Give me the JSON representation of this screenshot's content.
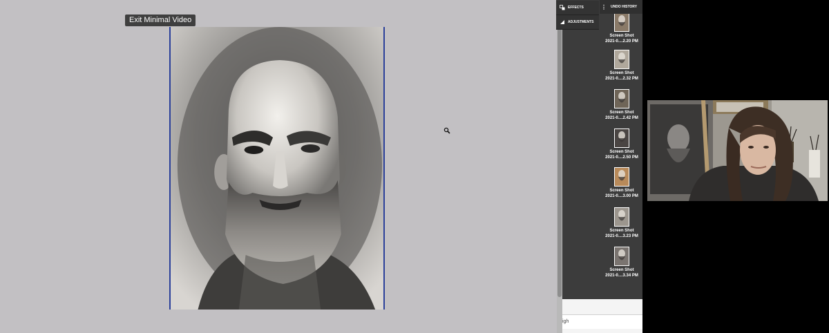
{
  "canvas": {
    "exit_button_label": "Exit Minimal Video",
    "background_color": "#c2c0c3"
  },
  "panel": {
    "tabs": [
      {
        "label": "EFFECTS",
        "icon": "effects-icon"
      },
      {
        "label": "ADJUSTMENTS",
        "icon": "adjustments-icon"
      }
    ],
    "undo_history_label": "UNDO HISTORY",
    "history_items": [
      {
        "line1": "Screen Shot",
        "line2": "2021-0....2.20 PM"
      },
      {
        "line1": "Screen Shot",
        "line2": "2021-0....2.32 PM"
      },
      {
        "line1": "Screen Shot",
        "line2": "2021-0....2.42 PM"
      },
      {
        "line1": "Screen Shot",
        "line2": "2021-0....2.50 PM"
      },
      {
        "line1": "Screen Shot",
        "line2": "2021-0....3.00 PM"
      },
      {
        "line1": "Screen Shot",
        "line2": "2021-0....3.23 PM"
      },
      {
        "line1": "Screen Shot",
        "line2": "2021-0....3.34 PM"
      }
    ],
    "bottom_field_text": "igh"
  },
  "colors": {
    "panel_bg": "#3c3c3c",
    "panel_text": "#ffffff",
    "drawing_border": "#2a3f9a"
  }
}
